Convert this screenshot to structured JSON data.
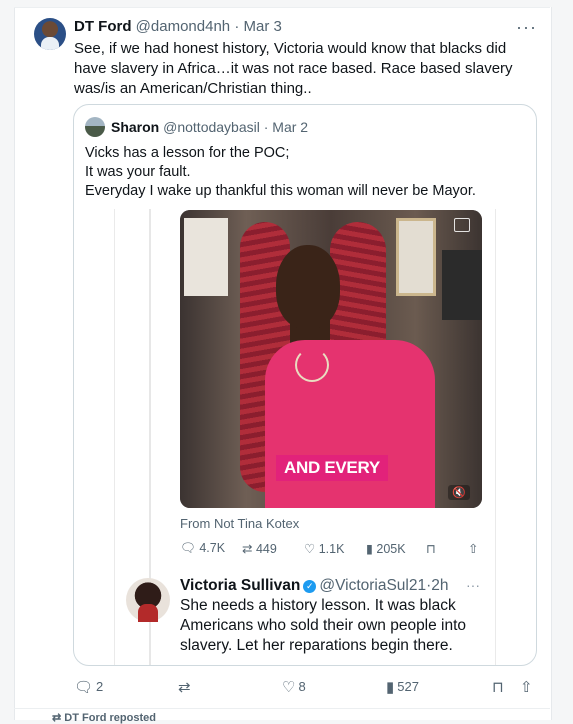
{
  "tweet": {
    "author_name": "DT Ford",
    "handle": "@damond4nh",
    "separator": "·",
    "date": "Mar 3",
    "more": "···",
    "text": "See, if we had honest history, Victoria would know that blacks did have slavery in Africa…it was not race based. Race based slavery was/is an American/Christian thing..",
    "actions": {
      "replies": "2",
      "retweets": "",
      "likes": "8",
      "views": "527"
    }
  },
  "quote": {
    "author_name": "Sharon",
    "handle": "@nottodaybasil",
    "separator": "·",
    "date": "Mar 2",
    "lines": [
      "Vicks has a lesson for the POC;",
      "It was your fault.",
      "Everyday I wake up thankful this woman will never be Mayor."
    ],
    "embedded": {
      "video_caption": "AND EVERY",
      "from_text": "From Not Tina Kotex",
      "actions": {
        "replies": "4.7K",
        "retweets": "449",
        "likes": "1.1K",
        "views": "205K"
      },
      "reply": {
        "author_name": "Victoria Sullivan",
        "handle": "@VictoriaSul21",
        "separator": "·",
        "time": "2h",
        "text": "She needs a history lesson.  It was black Americans who sold their own people into slavery.  Let her reparations begin there."
      }
    }
  },
  "footer": {
    "repost_text": "DT Ford reposted"
  },
  "icons": {
    "reply": "reply-icon",
    "retweet": "retweet-icon",
    "like": "heart-icon",
    "views": "analytics-icon",
    "bookmark": "bookmark-icon",
    "share": "share-icon"
  },
  "colors": {
    "verified": "#1d9bf0",
    "caption_bg": "#e2227a",
    "muted_text": "#536471"
  }
}
